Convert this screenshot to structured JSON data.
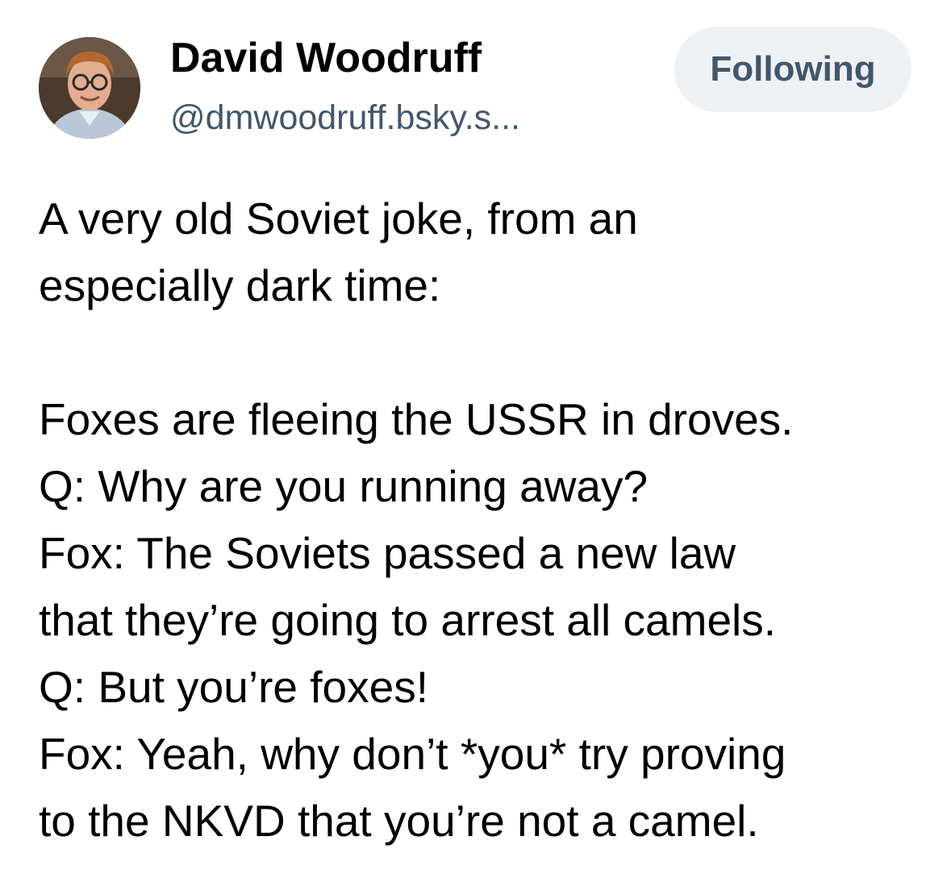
{
  "post": {
    "author": {
      "display_name": "David Woodruff",
      "handle": "@dmwoodruff.bsky.s...",
      "avatar_icon": "avatar-photo"
    },
    "follow_button_label": "Following",
    "text_lines": [
      "A very old Soviet joke, from an",
      "especially dark time:",
      "",
      "Foxes are fleeing the USSR in droves.",
      "Q: Why are you running away?",
      "Fox: The Soviets passed a new law",
      "that they’re going to arrest all camels.",
      "Q: But you’re foxes!",
      "Fox: Yeah, why don’t *you* try proving",
      "to the NKVD that you’re not a camel."
    ]
  },
  "colors": {
    "text": "#000000",
    "handle": "#42576c",
    "button_bg": "#eef1f4",
    "button_text": "#42576c"
  }
}
